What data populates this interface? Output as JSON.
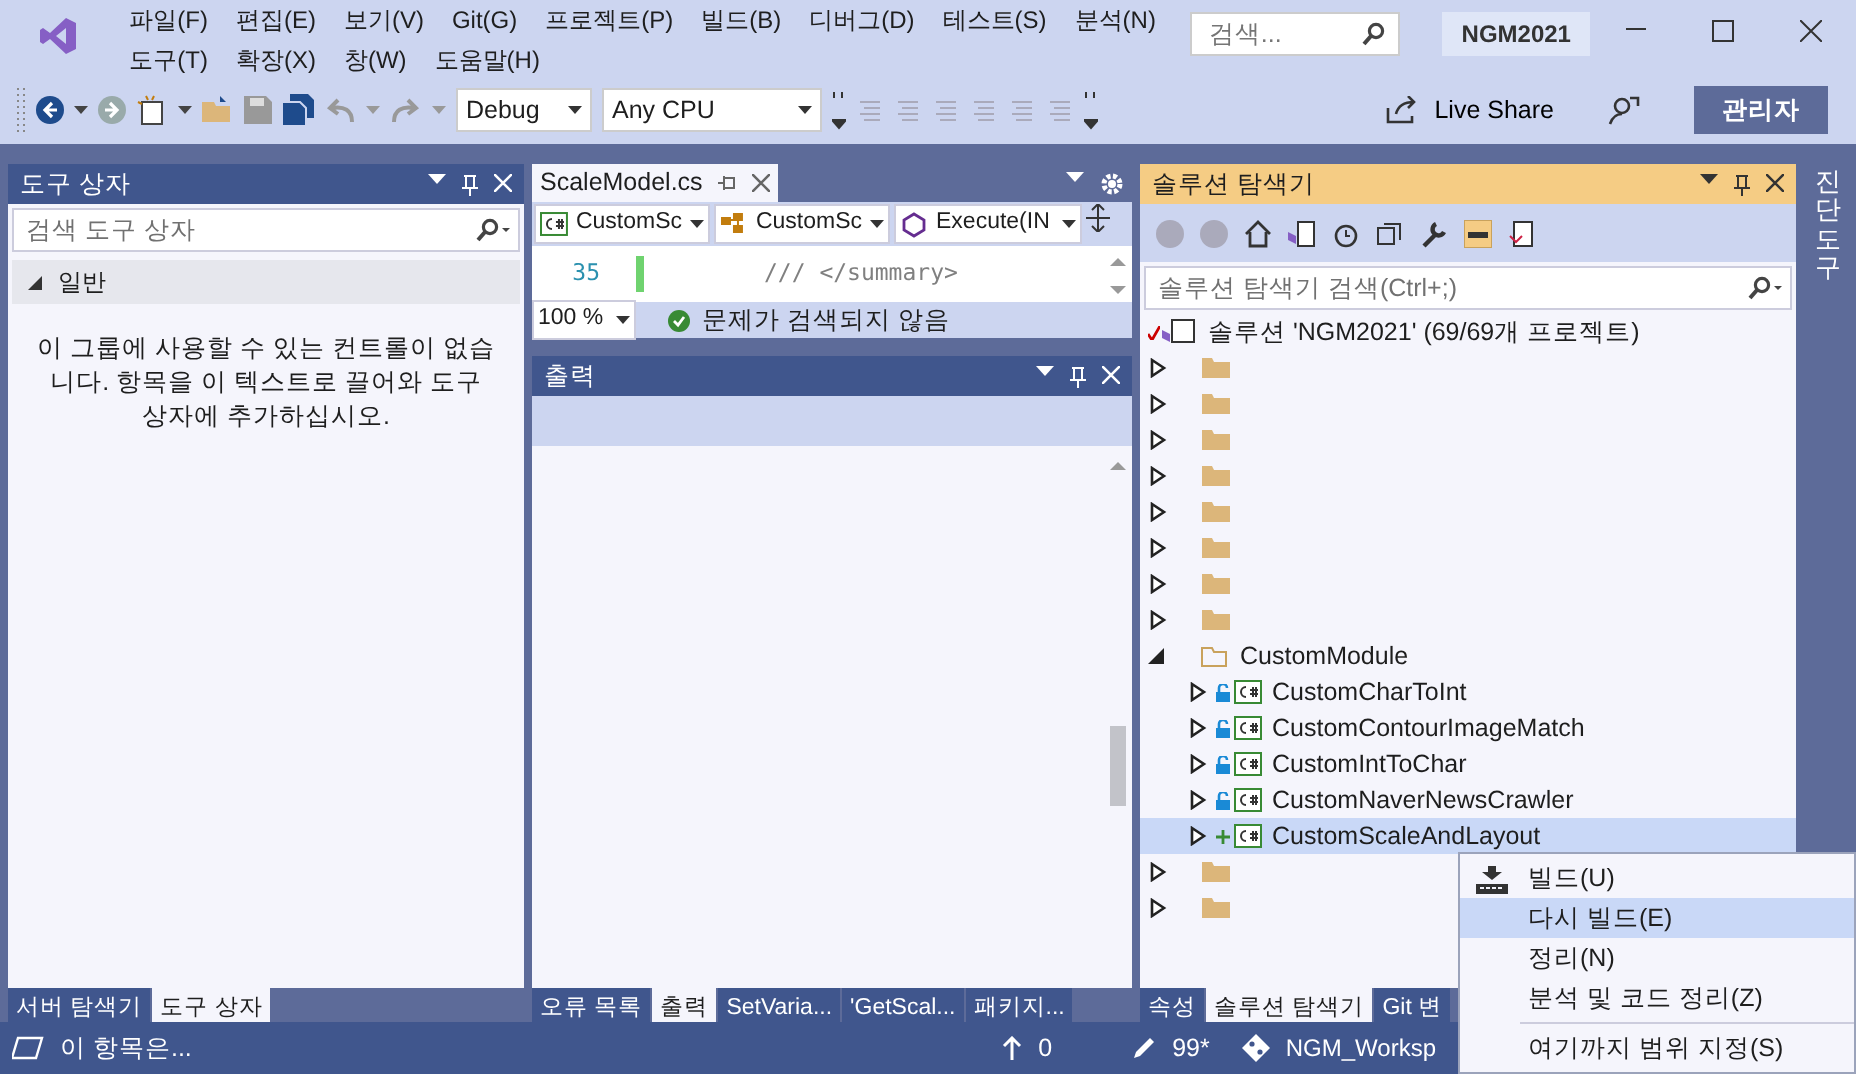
{
  "window": {
    "menu": [
      [
        "파일(F)",
        "편집(E)",
        "보기(V)",
        "Git(G)",
        "프로젝트(P)",
        "빌드(B)",
        "디버그(D)",
        "테스트(S)",
        "분석(N)"
      ],
      [
        "도구(T)",
        "확장(X)",
        "창(W)",
        "도움말(H)"
      ]
    ],
    "search": {
      "placeholder": "검색..."
    },
    "solution_name": "NGM2021"
  },
  "toolbar": {
    "configuration": "Debug",
    "platform": "Any CPU",
    "live_share": "Live Share",
    "admin": "관리자"
  },
  "toolbox": {
    "title": "도구 상자",
    "search": {
      "placeholder": "검색 도구 상자"
    },
    "group": {
      "label": "일반",
      "expanded": true
    },
    "message": "이 그룹에 사용할 수 있는 컨트롤이 없습니다. 항목을 이 텍스트로 끌어와 도구 상자에 추가하십시오.",
    "tabs": [
      {
        "label": "서버 탐색기",
        "selected": false
      },
      {
        "label": "도구 상자",
        "selected": true
      }
    ]
  },
  "editor": {
    "tab": "ScaleModel.cs",
    "nav": [
      "CustomSc",
      "CustomSc",
      "Execute(IN"
    ],
    "lines": [
      {
        "number": "35",
        "code": "/// </summary>"
      }
    ],
    "zoom": "100 %",
    "status": "문제가 검색되지 않음"
  },
  "output": {
    "title": "출력",
    "tabs": [
      {
        "label": "오류 목록",
        "selected": false
      },
      {
        "label": "출력",
        "selected": true
      },
      {
        "label": "SetVaria...",
        "selected": false
      },
      {
        "label": "'GetScal...",
        "selected": false
      },
      {
        "label": "패키지...",
        "selected": false
      }
    ]
  },
  "solution_explorer": {
    "title": "솔루션 탐색기",
    "search": {
      "placeholder": "솔루션 탐색기 검색(Ctrl+;)"
    },
    "tree": {
      "kind": "solution",
      "label": "솔루션 'NGM2021' (69/69개 프로젝트)",
      "selected": false,
      "children": [
        {
          "kind": "folder",
          "expanded": false,
          "selected": false
        },
        {
          "kind": "folder",
          "expanded": false,
          "selected": false
        },
        {
          "kind": "folder",
          "expanded": false,
          "selected": false
        },
        {
          "kind": "folder",
          "expanded": false,
          "selected": false
        },
        {
          "kind": "folder",
          "expanded": false,
          "selected": false
        },
        {
          "kind": "folder",
          "expanded": false,
          "selected": false
        },
        {
          "kind": "folder",
          "expanded": false,
          "selected": false
        },
        {
          "kind": "folder",
          "expanded": false,
          "selected": false
        },
        {
          "kind": "folder",
          "label": "CustomModule",
          "expanded": true,
          "selected": false,
          "children": [
            {
              "kind": "project",
              "label": "CustomCharToInt",
              "locked": true,
              "added": false,
              "expanded": false,
              "selected": false
            },
            {
              "kind": "project",
              "label": "CustomContourImageMatch",
              "locked": true,
              "added": false,
              "expanded": false,
              "selected": false
            },
            {
              "kind": "project",
              "label": "CustomIntToChar",
              "locked": true,
              "added": false,
              "expanded": false,
              "selected": false
            },
            {
              "kind": "project",
              "label": "CustomNaverNewsCrawler",
              "locked": true,
              "added": false,
              "expanded": false,
              "selected": false
            },
            {
              "kind": "project",
              "label": "CustomScaleAndLayout",
              "locked": false,
              "added": true,
              "expanded": false,
              "selected": true
            }
          ]
        },
        {
          "kind": "folder",
          "expanded": false,
          "selected": false
        },
        {
          "kind": "folder",
          "expanded": false,
          "selected": false
        }
      ]
    },
    "tabs": [
      {
        "label": "속성",
        "selected": false
      },
      {
        "label": "솔루션 탐색기",
        "selected": true
      },
      {
        "label": "Git 변",
        "selected": false
      }
    ]
  },
  "side_tab": "진단 도구",
  "context_menu": [
    {
      "label": "빌드(U)",
      "kind": "build",
      "selected": false
    },
    {
      "label": "다시 빌드(E)",
      "kind": "plain",
      "selected": true
    },
    {
      "label": "정리(N)",
      "kind": "plain",
      "selected": false
    },
    {
      "label": "분석 및 코드 정리(Z)",
      "kind": "plain",
      "selected": false
    },
    {
      "kind": "separator"
    },
    {
      "label": "여기까지 범위 지정(S)",
      "kind": "plain",
      "selected": false
    }
  ],
  "status_bar": {
    "message": "이 항목은...",
    "push": "0",
    "changes": "99*",
    "repo": "NGM_Worksp"
  }
}
